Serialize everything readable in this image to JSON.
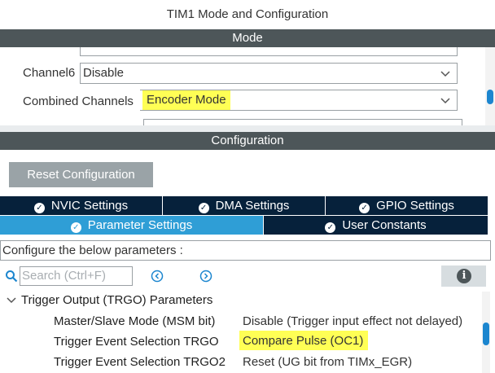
{
  "window": {
    "title": "TIM1 Mode and Configuration"
  },
  "mode": {
    "section_title": "Mode",
    "fields": [
      {
        "label": "Channel6",
        "value": "Disable"
      },
      {
        "label": "Combined Channels",
        "value": "Encoder Mode",
        "highlighted": true
      }
    ]
  },
  "configuration": {
    "section_title": "Configuration",
    "reset_button": "Reset Configuration",
    "tabs_row1": [
      "NVIC Settings",
      "DMA Settings",
      "GPIO Settings"
    ],
    "tabs_row2": [
      "Parameter Settings",
      "User Constants"
    ],
    "active_tab": "Parameter Settings",
    "description": "Configure the below parameters :",
    "search_placeholder": "Search (Ctrl+F)",
    "group": {
      "title": "Trigger Output (TRGO) Parameters",
      "params": [
        {
          "name": "Master/Slave Mode (MSM bit)",
          "value": "Disable (Trigger input effect not delayed)"
        },
        {
          "name": "Trigger Event Selection TRGO",
          "value": "Compare Pulse (OC1)",
          "highlighted": true
        },
        {
          "name": "Trigger Event Selection TRGO2",
          "value": "Reset (UG bit from TIMx_EGR)"
        }
      ]
    }
  },
  "icons": {
    "tab_status": "check-circle-icon",
    "search": "search-icon",
    "prev": "previous-circle-icon",
    "next": "next-circle-icon",
    "info": "info-icon",
    "expand": "chevron-down-icon"
  },
  "colors": {
    "section_bar": "#4d5659",
    "tab_dark": "#06213b",
    "tab_active": "#2f9ed6",
    "highlight": "#ffff55",
    "scroll_thumb": "#1c86cf"
  }
}
